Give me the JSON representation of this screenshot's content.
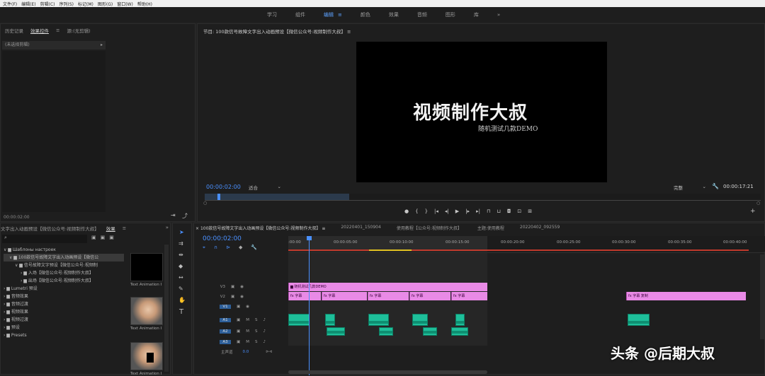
{
  "menu": [
    "文件(F)",
    "编辑(E)",
    "剪辑(C)",
    "序列(S)",
    "标记(M)",
    "图形(G)",
    "窗口(W)",
    "帮助(H)"
  ],
  "workspaces": [
    "学习",
    "组件",
    "编辑",
    "颜色",
    "效果",
    "音频",
    "图形",
    "库"
  ],
  "workspace_active": "编辑",
  "workspace_more": "»",
  "left_tabs": [
    "历史记录",
    "效果控件",
    "源:(无剪辑)"
  ],
  "left_tab_menu": "≡",
  "no_clip": "(未选择剪辑)",
  "left_time": "00:00:02:00",
  "program": {
    "title": "节目: 100款信号故障文字出入动画预设【微信公众号:视频制作大叔】",
    "video_title": "视频制作大叔",
    "video_subtitle": "随机测试几款DEMO",
    "timecode": "00:00:02:00",
    "fit": "适合",
    "quality": "完整",
    "duration": "00:00:17:21"
  },
  "project": {
    "tab_title": "文字出入动画预设【微信公众号:视频制作大叔】",
    "tab_effects": "效果",
    "tree": [
      "Шаблоны настроек",
      "100款信号故障文字出入动画预设【微信公",
      "信号故障文字预设【微信公众号:视频制",
      "入场【微信公众号:视频制作大叔】",
      "出场【微信公众号:视频制作大叔】",
      "Lumetri 预设",
      "音频效果",
      "音频过渡",
      "视频效果",
      "视频过渡",
      "预设",
      "Presets"
    ],
    "thumb_labels": [
      "Text Animation I",
      "Text Animation I",
      "Text Animation I"
    ]
  },
  "timeline": {
    "tabs": [
      "100款信号故障文字出入动画预设【微信公众号:视频制作大叔】",
      "20220401_150904",
      "使用教程【公众号:视频制作大叔】",
      "主题:使用教程",
      "20220402_092559"
    ],
    "timecode": "00:00:02:00",
    "ruler": [
      ":00:00",
      "00:00:05:00",
      "00:00:10:00",
      "00:00:15:00",
      "00:00:20:00",
      "00:00:25:00",
      "00:00:30:00",
      "00:00:35:00",
      "00:00:40:00"
    ],
    "tracks_v": [
      "V3",
      "V2",
      "V1"
    ],
    "tracks_a": [
      "A1",
      "A2",
      "A3"
    ],
    "master": "主声道",
    "master_val": "0.0",
    "mute": "M",
    "solo": "S",
    "v3_clip": "随机测试几款DEMO",
    "v2_clip": "字幕",
    "v2_clip_far": "字幕 复制"
  },
  "watermark": "头条 @后期大叔"
}
